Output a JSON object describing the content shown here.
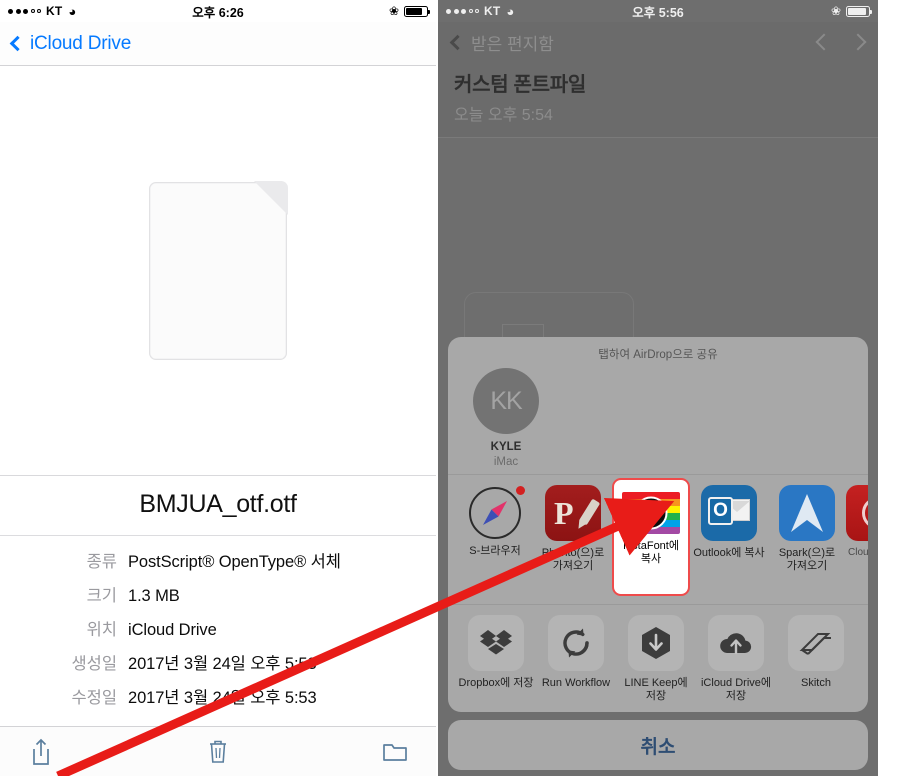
{
  "left": {
    "status": {
      "carrier": "KT",
      "time": "오후 6:26",
      "signal_dots_filled": 3,
      "signal_dots_total": 5
    },
    "navbar": {
      "back_label": "iCloud Drive"
    },
    "file": {
      "name": "BMJUA_otf.otf",
      "metadata": [
        {
          "key": "종류",
          "value": "PostScript® OpenType® 서체"
        },
        {
          "key": "크기",
          "value": "1.3 MB"
        },
        {
          "key": "위치",
          "value": "iCloud Drive"
        },
        {
          "key": "생성일",
          "value": "2017년 3월 24일 오후 5:53"
        },
        {
          "key": "수정일",
          "value": "2017년 3월 24일 오후 5:53"
        }
      ]
    },
    "toolbar": {
      "share": "share-icon",
      "trash": "trash-icon",
      "folder": "folder-icon"
    }
  },
  "right": {
    "status": {
      "carrier": "KT",
      "time": "오후 5:56",
      "signal_dots_filled": 3,
      "signal_dots_total": 5
    },
    "navbar": {
      "back_label": "받은 편지함"
    },
    "mail": {
      "subject": "커스텀 폰트파일",
      "date": "오늘 오후 5:54"
    },
    "share_sheet": {
      "airdrop": {
        "title": "탭하여 AirDrop으로 공유",
        "person": {
          "initials": "KK",
          "name": "KYLE",
          "device": "iMac"
        }
      },
      "apps": [
        {
          "label": "S-브라우저",
          "icon": "safari-icon",
          "highlighted": false
        },
        {
          "label": "Phonto(으)로 가져오기",
          "icon": "phonto-icon",
          "highlighted": false
        },
        {
          "label": "InstaFont에 복사",
          "icon": "instafont-icon",
          "highlighted": true
        },
        {
          "label": "Outlook에 복사",
          "icon": "outlook-icon",
          "highlighted": false
        },
        {
          "label": "Spark(으)로 가져오기",
          "icon": "spark-icon",
          "highlighted": false
        },
        {
          "label": "Clou",
          "icon": "partial-red-app-icon",
          "highlighted": false
        }
      ],
      "actions": [
        {
          "label": "Dropbox에 저장",
          "icon": "dropbox-icon"
        },
        {
          "label": "Run Workflow",
          "icon": "refresh-icon"
        },
        {
          "label": "LINE Keep에 저장",
          "icon": "line-keep-icon"
        },
        {
          "label": "iCloud Drive에 저장",
          "icon": "icloud-upload-icon"
        },
        {
          "label": "Skitch",
          "icon": "skitch-icon"
        }
      ],
      "cancel_label": "취소"
    }
  },
  "annotation": {
    "arrow_color": "#e81c18",
    "from": "share-icon",
    "to": "instafont-icon"
  },
  "colors": {
    "ios_blue": "#067aff",
    "cancel_blue": "#2e4d73",
    "highlight_red": "#ef4b4b",
    "sheet_gray": "#a8a8a8"
  }
}
